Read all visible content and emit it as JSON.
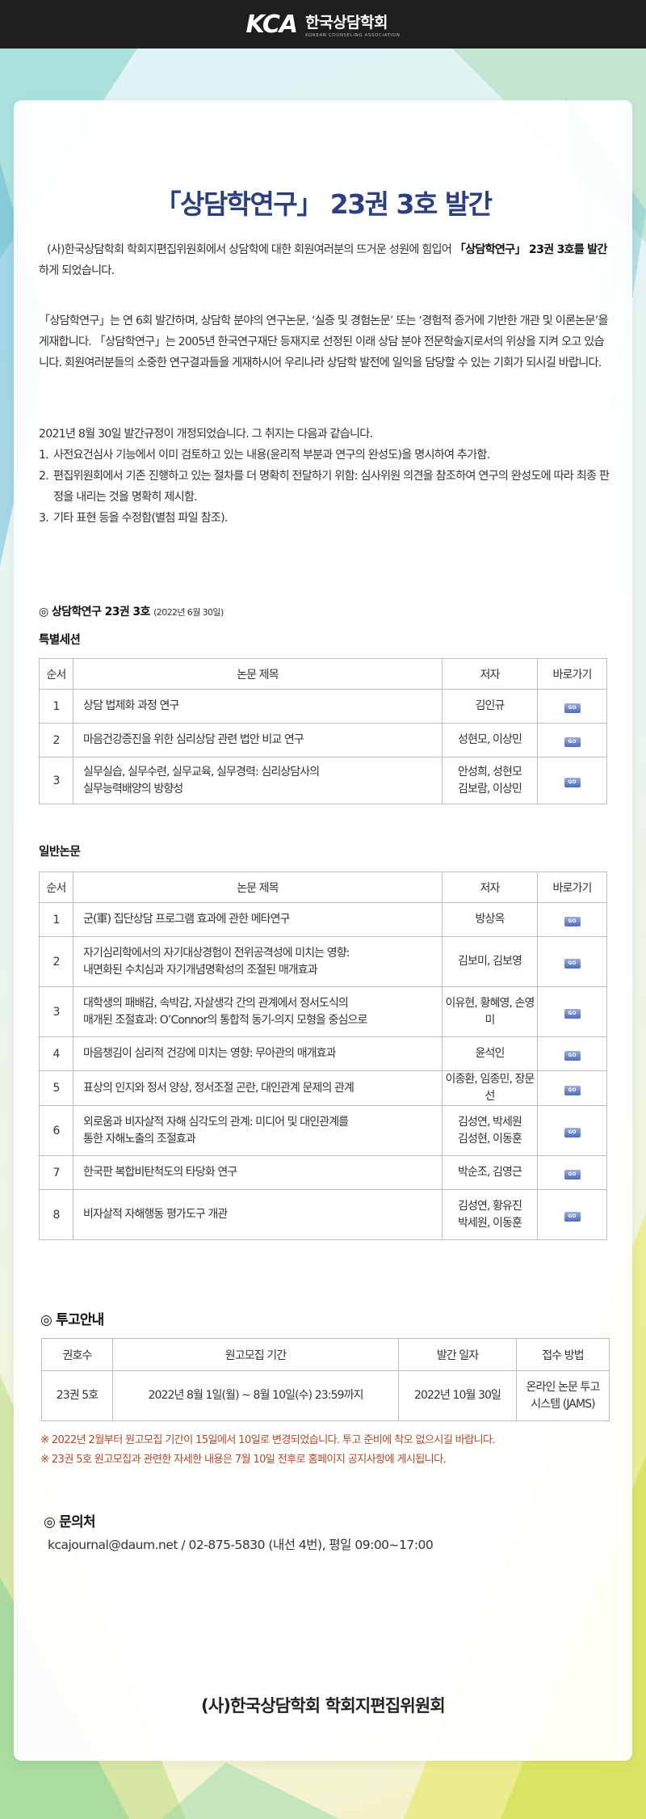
{
  "header": {
    "logo_mark": "KCA",
    "logo_name": "한국상담학회",
    "logo_sub": "KOREAN COUNSELING ASSOCIATION"
  },
  "title": "「상담학연구」 23권 3호 발간",
  "intro": {
    "p1_pre": "(사)한국상담학회 학회지편집위원회에서 상담학에 대한 회원여러분의 뜨거운 성원에 힘입어 ",
    "p1_bold": "「상담학연구」 23권 3호를 발간",
    "p1_post": "하게 되었습니다.",
    "p2": "「상담학연구」는 연 6회 발간하며, 상담학 분야의 연구논문, ‘실증 및 경험논문’ 또는 ‘경험적 증거에 기반한 개관 및 이론논문’을 게재합니다. 「상담학연구」는 2005년 한국연구재단 등재지로 선정된 이래 상담 분야 전문학술지로서의 위상을 지켜 오고 있습니다. 회원여러분들의 소중한 연구결과들을 게재하시어 우리나라 상담학 발전에 일익을 담당할 수 있는 기회가 되시길 바랍니다.",
    "p3": "2021년 8월 30일 발간규정이 개정되었습니다. 그 취지는 다음과 같습니다.",
    "rules": [
      {
        "num": "1.",
        "text": "사전요건심사 기능에서 이미 검토하고 있는 내용(윤리적 부분과 연구의 완성도)을 명시하여 추가함."
      },
      {
        "num": "2.",
        "text": "편집위원회에서 기존 진행하고 있는 절차를 더 명확히 전달하기 위함: 심사위원 의견을 참조하여 연구의 완성도에 따라 최종 판정을 내리는 것을 명확히 제시함."
      },
      {
        "num": "3.",
        "text": "기타 표현 등을 수정함(별첨 파일 참조)."
      }
    ]
  },
  "issue": {
    "heading": "◎ 상담학연구 23권 3호",
    "date": "(2022년 6월 30일)"
  },
  "columns": {
    "no": "순서",
    "title": "논문 제목",
    "author": "저자",
    "go": "바로가기"
  },
  "go_label": "GO",
  "special": {
    "heading": "특별세션",
    "rows": [
      {
        "no": "1",
        "title": [
          "상담 법제화 과정 연구"
        ],
        "author": [
          "김인규"
        ]
      },
      {
        "no": "2",
        "title": [
          "마음건강증진을 위한 심리상담 관련 법안 비교 연구"
        ],
        "author": [
          "성현모, 이상민"
        ]
      },
      {
        "no": "3",
        "title": [
          "실무실습, 실무수련, 실무교육, 실무경력: 심리상담사의",
          "실무능력배양의 방향성"
        ],
        "author": [
          "안성희, 성현모",
          "김보람, 이상민"
        ]
      }
    ]
  },
  "general": {
    "heading": "일반논문",
    "rows": [
      {
        "no": "1",
        "title": [
          "군(軍) 집단상담 프로그램 효과에 관한 메타연구"
        ],
        "author": [
          "방상옥"
        ]
      },
      {
        "no": "2",
        "title": [
          "자기심리학에서의 자기대상경험이 전위공격성에 미치는 영향:",
          "내면화된 수치심과 자기개념명확성의 조절된 매개효과"
        ],
        "author": [
          "김보미, 김보영"
        ]
      },
      {
        "no": "3",
        "title": [
          "대학생의 패배감, 속박감, 자살생각 간의 관계에서 정서도식의",
          "매개된 조절효과: O’Connor의 통합적 동기-의지 모형을 중심으로"
        ],
        "author": [
          "이유현, 황혜영, 손영미"
        ]
      },
      {
        "no": "4",
        "title": [
          "마음챙김이 심리적 건강에 미치는 영향: 무아관의 매개효과"
        ],
        "author": [
          "윤석인"
        ]
      },
      {
        "no": "5",
        "title": [
          "표상의 인지와 정서 양상, 정서조절 곤란, 대인관계 문제의 관계"
        ],
        "author": [
          "이종환, 임종민, 장문선"
        ]
      },
      {
        "no": "6",
        "title": [
          "외로움과 비자살적 자해 심각도의 관계: 미디어 및 대인관계를",
          "통한 자해노출의 조절효과"
        ],
        "author": [
          "김성연, 박세원",
          "김성현, 이동훈"
        ]
      },
      {
        "no": "7",
        "title": [
          "한국판 복합비탄척도의 타당화 연구"
        ],
        "author": [
          "박순조, 김영근"
        ]
      },
      {
        "no": "8",
        "title": [
          "비자살적 자해행동 평가도구 개관"
        ],
        "author": [
          "김성연, 황유진",
          "박세원, 이동훈"
        ]
      }
    ]
  },
  "submission": {
    "heading": "◎ 투고안내",
    "columns": {
      "issue": "권호수",
      "period": "원고모집 기간",
      "date": "발간 일자",
      "method": "접수 방법"
    },
    "row": {
      "issue": "23권 5호",
      "period": "2022년 8월 1일(월) ~ 8월 10일(수) 23:59까지",
      "date": "2022년 10월 30일",
      "method": [
        "온라인 논문 투고",
        "시스템 (JAMS)"
      ]
    },
    "notes": [
      "※ 2022년 2월부터 원고모집 기간이 15일에서 10일로 변경되었습니다. 투고 준비에 착오 없으시길 바랍니다.",
      "※ 23권 5호 원고모집과 관련한 자세한 내용은 7월 10일 전후로 홈페이지 공지사항에 게시됩니다."
    ]
  },
  "contact": {
    "heading": "◎ 문의처",
    "text": "kcajournal@daum.net / 02-875-5830 (내선 4번), 평일 09:00~17:00"
  },
  "footer": {
    "signature": "(사)한국상담학회 학회지편집위원회"
  },
  "colors": {
    "title": "#2c3f7c",
    "notice": "#b24a2e",
    "topbar": "#1e1e1e"
  }
}
